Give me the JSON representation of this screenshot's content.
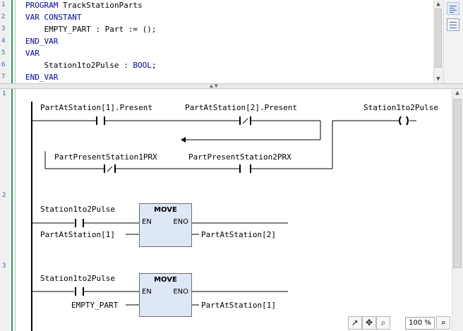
{
  "declaration": {
    "line_numbers": [
      "1",
      "2",
      "3",
      "4",
      "5",
      "6",
      "7"
    ],
    "lines": [
      {
        "k": "PROGRAM",
        "t": " TrackStationParts"
      },
      {
        "k": "VAR CONSTANT",
        "t": ""
      },
      {
        "k": "",
        "t": "    EMPTY_PART : Part := ();"
      },
      {
        "k": "END_VAR",
        "t": ""
      },
      {
        "k": "VAR",
        "t": ""
      },
      {
        "k": "",
        "t": "    Station1to2Pulse : ",
        "k2": "BOOL",
        "t2": ";"
      },
      {
        "k": "END_VAR",
        "t": ""
      }
    ]
  },
  "ladder": {
    "rung_numbers": [
      "1",
      "2",
      "3"
    ],
    "rung1": {
      "contact1": "PartAtStation[1].Present",
      "contact2": "PartAtStation[2].Present",
      "coil": "Station1to2Pulse",
      "contact3": "PartPresentStation1PRX",
      "contact4": "PartPresentStation2PRX"
    },
    "rung2": {
      "contact": "Station1to2Pulse",
      "fb_title": "MOVE",
      "en": "EN",
      "eno": "ENO",
      "input": "PartAtStation[1]",
      "output": "PartAtStation[2]"
    },
    "rung3": {
      "contact": "Station1to2Pulse",
      "fb_title": "MOVE",
      "en": "EN",
      "eno": "ENO",
      "input": "EMPTY_PART",
      "output": "PartAtStation[1]"
    }
  },
  "toolbar": {
    "zoom": "100 %",
    "pointer_icon": "pointer-icon",
    "pan_icon": "pan-icon",
    "magnify_icon": "magnify-icon"
  },
  "colors": {
    "keyword": "#0000c8",
    "fb_fill": "#dde7f5",
    "rail": "#1e9e5a"
  }
}
